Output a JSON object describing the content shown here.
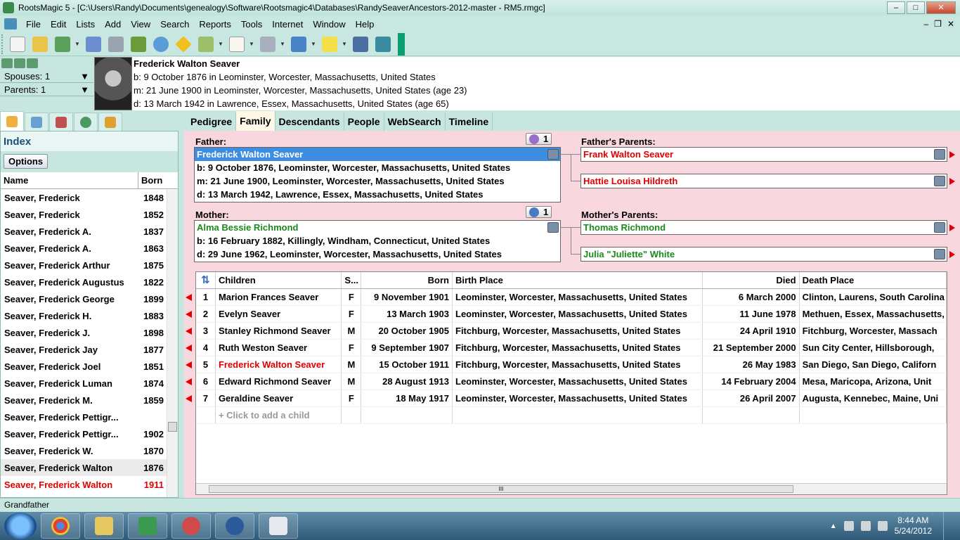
{
  "window": {
    "title": "RootsMagic 5 - [C:\\Users\\Randy\\Documents\\genealogy\\Software\\Rootsmagic4\\Databases\\RandySeaverAncestors-2012-master - RM5.rmgc]",
    "minimize": "–",
    "maximize": "□",
    "close": "✕"
  },
  "menu": {
    "items": [
      "File",
      "Edit",
      "Lists",
      "Add",
      "View",
      "Search",
      "Reports",
      "Tools",
      "Internet",
      "Window",
      "Help"
    ],
    "mdi_min": "–",
    "mdi_restore": "❐",
    "mdi_close": "✕"
  },
  "left_mini": {
    "spouses": "Spouses: 1",
    "parents": "Parents: 1",
    "dropdown_glyph": "▼"
  },
  "person": {
    "name": "Frederick Walton Seaver",
    "birth": "b: 9 October 1876 in Leominster, Worcester, Massachusetts, United States",
    "marriage": "m: 21 June 1900 in Leominster, Worcester, Massachusetts, United States (age 23)",
    "death": "d: 13 March 1942 in Lawrence, Essex, Massachusetts, United States (age 65)"
  },
  "index": {
    "title": "Index",
    "options": "Options",
    "col_name": "Name",
    "col_born": "Born",
    "rows": [
      {
        "name": "Seaver, Frederick",
        "born": "1848"
      },
      {
        "name": "Seaver, Frederick",
        "born": "1852"
      },
      {
        "name": "Seaver, Frederick A.",
        "born": "1837"
      },
      {
        "name": "Seaver, Frederick A.",
        "born": "1863"
      },
      {
        "name": "Seaver, Frederick Arthur",
        "born": "1875"
      },
      {
        "name": "Seaver, Frederick Augustus",
        "born": "1822"
      },
      {
        "name": "Seaver, Frederick George",
        "born": "1899"
      },
      {
        "name": "Seaver, Frederick H.",
        "born": "1883"
      },
      {
        "name": "Seaver, Frederick J.",
        "born": "1898"
      },
      {
        "name": "Seaver, Frederick Jay",
        "born": "1877"
      },
      {
        "name": "Seaver, Frederick Joel",
        "born": "1851"
      },
      {
        "name": "Seaver, Frederick Luman",
        "born": "1874"
      },
      {
        "name": "Seaver, Frederick M.",
        "born": "1859"
      },
      {
        "name": "Seaver, Frederick Pettigr...",
        "born": ""
      },
      {
        "name": "Seaver, Frederick Pettigr...",
        "born": "1902"
      },
      {
        "name": "Seaver, Frederick W.",
        "born": "1870"
      },
      {
        "name": "Seaver, Frederick Walton",
        "born": "1876"
      },
      {
        "name": "Seaver, Frederick Walton",
        "born": "1911"
      }
    ]
  },
  "tabs": [
    "Pedigree",
    "Family",
    "Descendants",
    "People",
    "WebSearch",
    "Timeline"
  ],
  "family": {
    "father_label": "Father:",
    "father_spouse_count": "1",
    "father": {
      "name": "Frederick Walton Seaver",
      "birth": "b: 9 October 1876, Leominster, Worcester, Massachusetts, United States",
      "marriage": "m: 21 June 1900, Leominster, Worcester, Massachusetts, United States",
      "death": "d: 13 March 1942, Lawrence, Essex, Massachusetts, United States"
    },
    "mother_label": "Mother:",
    "mother_spouse_count": "1",
    "mother": {
      "name": "Alma Bessie Richmond",
      "birth": "b: 16 February 1882, Killingly, Windham, Connecticut, United States",
      "death": "d: 29 June 1962, Leominster, Worcester, Massachusetts, United States"
    },
    "fathers_parents_label": "Father's Parents:",
    "fathers_father": "Frank Walton Seaver",
    "fathers_mother": "Hattie Louisa Hildreth",
    "mothers_parents_label": "Mother's Parents:",
    "mothers_father": "Thomas Richmond",
    "mothers_mother": "Julia \"Juliette\" White"
  },
  "children": {
    "sort_glyph": "⇅",
    "headers": {
      "children": "Children",
      "sex": "S...",
      "born": "Born",
      "birth_place": "Birth Place",
      "died": "Died",
      "death_place": "Death Place"
    },
    "rows": [
      {
        "num": "1",
        "name": "Marion Frances Seaver",
        "sex": "F",
        "born": "9 November 1901",
        "birth_place": "Leominster, Worcester, Massachusetts, United States",
        "died": "6 March 2000",
        "death_place": "Clinton, Laurens, South Carolina"
      },
      {
        "num": "2",
        "name": "Evelyn Seaver",
        "sex": "F",
        "born": "13 March 1903",
        "birth_place": "Leominster, Worcester, Massachusetts, United States",
        "died": "11 June 1978",
        "death_place": "Methuen, Essex, Massachusetts,"
      },
      {
        "num": "3",
        "name": "Stanley Richmond Seaver",
        "sex": "M",
        "born": "20 October 1905",
        "birth_place": "Fitchburg, Worcester, Massachusetts, United States",
        "died": "24 April 1910",
        "death_place": "Fitchburg, Worcester, Massach"
      },
      {
        "num": "4",
        "name": "Ruth Weston Seaver",
        "sex": "F",
        "born": "9 September 1907",
        "birth_place": "Fitchburg, Worcester, Massachusetts, United States",
        "died": "21 September 2000",
        "death_place": "Sun City Center, Hillsborough,"
      },
      {
        "num": "5",
        "name": "Frederick Walton Seaver",
        "sex": "M",
        "born": "15 October 1911",
        "birth_place": "Fitchburg, Worcester, Massachusetts, United States",
        "died": "26 May 1983",
        "death_place": "San Diego, San Diego, Californ"
      },
      {
        "num": "6",
        "name": "Edward Richmond Seaver",
        "sex": "M",
        "born": "28 August 1913",
        "birth_place": "Leominster, Worcester, Massachusetts, United States",
        "died": "14 February 2004",
        "death_place": "Mesa, Maricopa, Arizona, Unit"
      },
      {
        "num": "7",
        "name": "Geraldine Seaver",
        "sex": "F",
        "born": "18 May 1917",
        "birth_place": "Leominster, Worcester, Massachusetts, United States",
        "died": "26 April 2007",
        "death_place": "Augusta, Kennebec, Maine, Uni"
      }
    ],
    "add_child": "+ Click to add a child",
    "scroll_grip": "III"
  },
  "status": {
    "text": "Grandfather"
  },
  "taskbar": {
    "time": "8:44 AM",
    "date": "5/24/2012"
  },
  "colors": {
    "accent_teal": "#c7e6e0",
    "family_bg": "#f9d7de",
    "selected_blue": "#3d8ee0",
    "male_red": "#e00000",
    "female_green": "#1a8a1a"
  }
}
